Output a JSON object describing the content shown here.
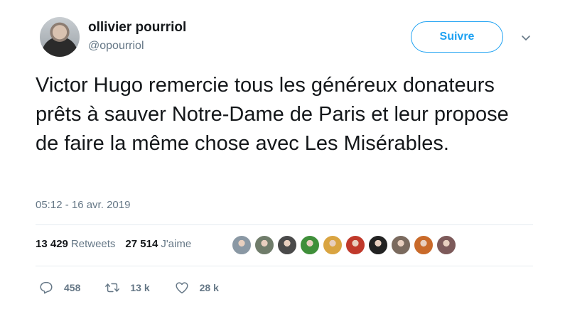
{
  "author": {
    "name": "ollivier pourriol",
    "handle": "@opourriol"
  },
  "follow_button": {
    "label": "Suivre"
  },
  "menu": {
    "icon": "chevron-down-icon"
  },
  "tweet": {
    "text": "Victor Hugo remercie tous les généreux donateurs prêts à sauver Notre-Dame de Paris et leur propose de faire la même chose avec Les Misérables.",
    "timestamp": "05:12 - 16 avr. 2019"
  },
  "stats": {
    "retweets_count": "13 429",
    "retweets_label": "Retweets",
    "likes_count": "27 514",
    "likes_label": "J'aime"
  },
  "likers": {
    "colors": [
      "#8a98a4",
      "#6f7c6a",
      "#4a4a4a",
      "#3f8f3a",
      "#d9a441",
      "#c0392b",
      "#222222",
      "#7a6a5e",
      "#c96a2a",
      "#7d5a5a"
    ]
  },
  "actions": {
    "reply_count": "458",
    "retweet_count": "13 k",
    "like_count": "28 k"
  },
  "colors": {
    "accent": "#1da1f2",
    "secondary_text": "#657786",
    "primary_text": "#14171a",
    "divider": "#e6ecf0"
  }
}
